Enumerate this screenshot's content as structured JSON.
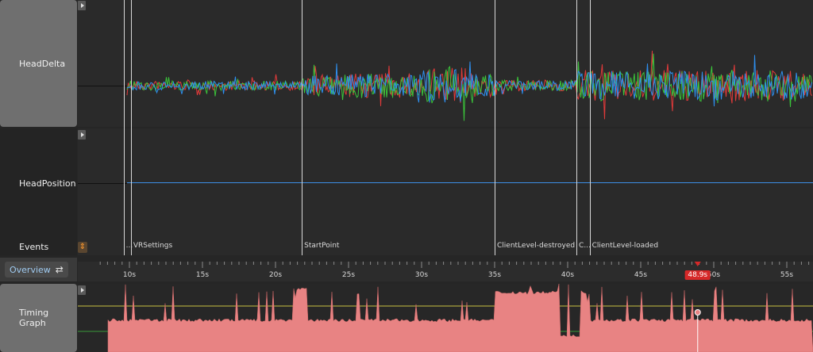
{
  "tracks": {
    "head_delta": {
      "label": "HeadDelta"
    },
    "head_position": {
      "label": "HeadPosition"
    },
    "events": {
      "label": "Events"
    },
    "timing_graph": {
      "label": "Timing Graph"
    }
  },
  "overview": {
    "label": "Overview"
  },
  "timeline": {
    "ticks": [
      "10s",
      "15s",
      "20s",
      "25s",
      "30s",
      "35s",
      "40s",
      "45s",
      "50s",
      "55s"
    ],
    "playhead_label": "48.9s"
  },
  "events": [
    {
      "label": "...",
      "time": 9.6
    },
    {
      "label": "VRSettings",
      "time": 10.1
    },
    {
      "label": "StartPoint",
      "time": 21.8
    },
    {
      "label": "ClientLevel-destroyed",
      "time": 35.0
    },
    {
      "label": "C...",
      "time": 40.6
    },
    {
      "label": "ClientLevel-loaded",
      "time": 41.5
    }
  ],
  "colors": {
    "accent": "#3d8fe6",
    "series_red": "#e03a3a",
    "series_green": "#3ac43a",
    "series_blue": "#2e8fef",
    "timing_fill": "#e88383",
    "playhead": "#d62828"
  },
  "icons": {
    "expand": "chevron-right-icon",
    "overview_toggle": "swap-arrows-icon",
    "sort": "sort-icon"
  }
}
